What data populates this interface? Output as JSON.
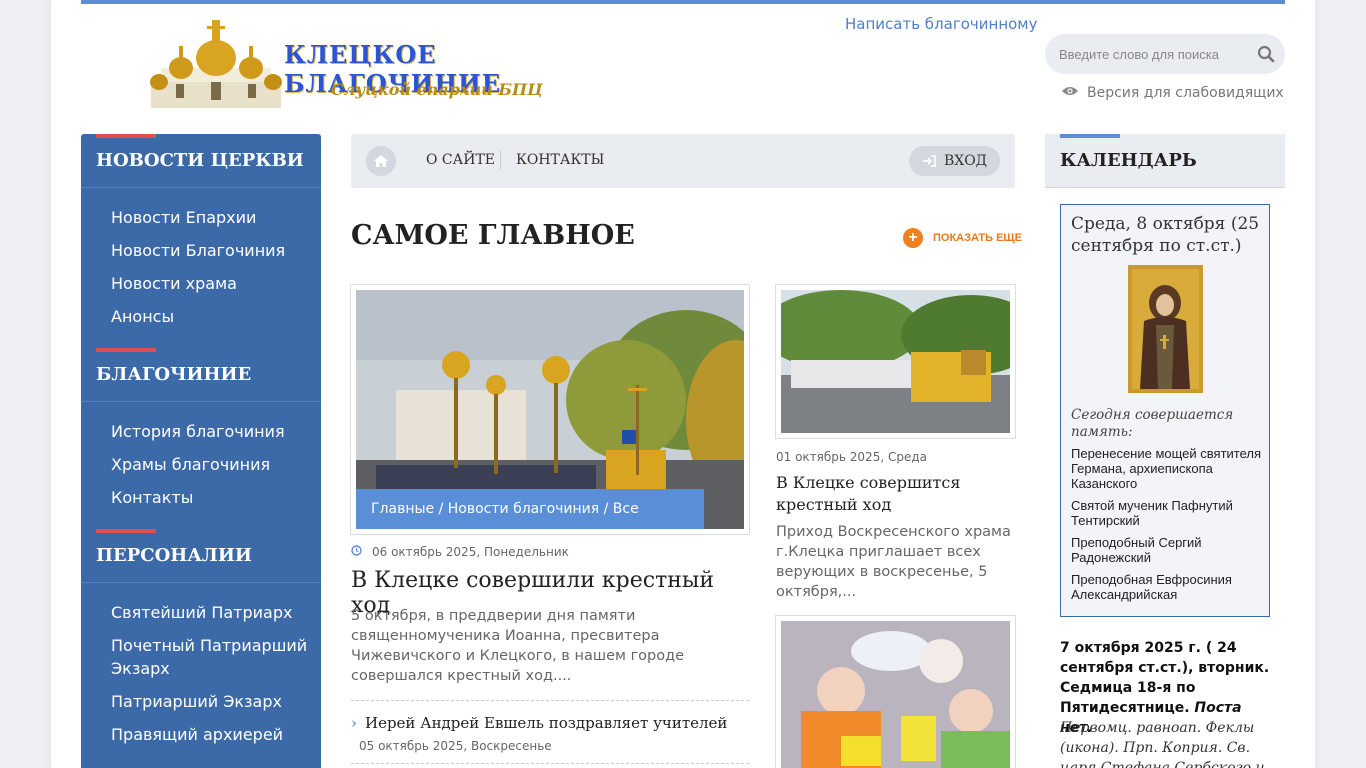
{
  "header": {
    "logo_title": "КЛЕЦКОЕ БЛАГОЧИНИЕ",
    "logo_subtitle": "Слуцкой епархии БПЦ",
    "write_link": "Написать благочинному",
    "search_placeholder": "Введите слово для поиска",
    "low_vision": "Версия для слабовидящих"
  },
  "sidebar": {
    "sections": [
      {
        "title": "НОВОСТИ ЦЕРКВИ",
        "items": [
          "Новости Епархии",
          "Новости Благочиния",
          "Новости храма",
          "Анонсы"
        ]
      },
      {
        "title": "БЛАГОЧИНИЕ",
        "items": [
          "История благочиния",
          "Храмы благочиния",
          "Контакты"
        ]
      },
      {
        "title": "ПЕРСОНАЛИИ",
        "items": [
          "Святейший Патриарх",
          "Почетный Патриарший Экзарх",
          "Патриарший Экзарх",
          "Правящий архиерей"
        ]
      }
    ]
  },
  "nav": {
    "about": "О САЙТЕ",
    "contacts": "КОНТАКТЫ",
    "login": "ВХОД"
  },
  "main": {
    "title": "САМОЕ ГЛАВНОЕ",
    "show_more": "ПОКАЗАТЬ ЕЩЕ",
    "featured": {
      "caption": "Главные / Новости благочиния / Все Новости",
      "date": "06 октябрь 2025, Понедельник",
      "title": "В Клецке совершили крестный ход",
      "excerpt": "5 октября, в преддверии дня памяти священномученика Иоанна, пресвитера Чижевичского и Клецкого, в нашем городе совершался крестный ход...."
    },
    "sub_item": {
      "title": "Иерей Андрей Евшель поздравляет учителей",
      "date": "05 октябрь 2025, Воскресенье"
    },
    "card2": {
      "date": "01 октябрь 2025, Среда",
      "title": "В Клецке совершится крестный ход",
      "excerpt": "Приход Воскресенского храма г.Клецка приглашает всех верующих в воскресенье, 5 октября,..."
    }
  },
  "calendar": {
    "title": "КАЛЕНДАРЬ",
    "date": "Среда, 8 октября (25 сентября по ст.ст.)",
    "today_label": "Сегодня совершается память:",
    "saints": [
      "Перенесение мощей святителя Германа, архиепископа Казанского",
      "Святой мученик Пафнутий Тентирский",
      "Преподобный Сергий Радонежский",
      "Преподобная Евфросиния Александрийская"
    ],
    "week_text": "7 октября 2025 г. ( 24 сентября ст.ст.), вторник. Седмица 18-я по Пятидесятнице.",
    "fast_text": "Поста нет.",
    "memory_text": "Первомц. равноап. Феклы (икона). Прп. Коприя. Св. царя Стефана Сербского и сына его"
  },
  "colors": {
    "accent": "#5b8dd6",
    "sidebar": "#3c6aa8",
    "section_bar": "#e05050",
    "show_more": "#e8781e"
  }
}
